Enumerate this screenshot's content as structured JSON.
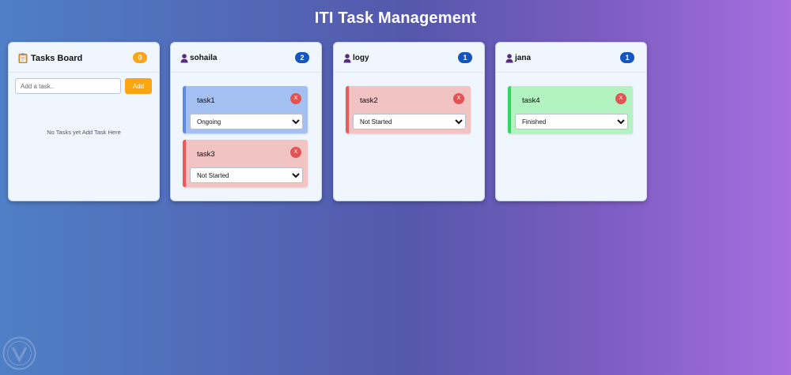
{
  "app": {
    "title": "ITI Task Management"
  },
  "board": {
    "title": "Tasks Board",
    "icon": "clipboard-icon",
    "count": "0",
    "input_placeholder": "Add a task..",
    "add_label": "Add",
    "empty_message": "No Tasks yet Add Task Here"
  },
  "status_options": [
    "Not Started",
    "Ongoing",
    "Finished"
  ],
  "users": [
    {
      "name": "sohaila",
      "icon": "user-icon",
      "count": "2",
      "tasks": [
        {
          "name": "task1",
          "status": "Ongoing",
          "delete_label": "X"
        },
        {
          "name": "task3",
          "status": "Not Started",
          "delete_label": "X"
        }
      ]
    },
    {
      "name": "logy",
      "icon": "user-icon",
      "count": "1",
      "tasks": [
        {
          "name": "task2",
          "status": "Not Started",
          "delete_label": "X"
        }
      ]
    },
    {
      "name": "jana",
      "icon": "user-icon",
      "count": "1",
      "tasks": [
        {
          "name": "task4",
          "status": "Finished",
          "delete_label": "X"
        }
      ]
    }
  ],
  "colors": {
    "board_badge": "#f9a51a",
    "user_badge": "#1455c0",
    "ongoing": "#a4c0f3",
    "not_started": "#f1c3c3",
    "finished": "#b3f3c2",
    "add_button": "#fba512",
    "delete_button": "#e25353"
  }
}
